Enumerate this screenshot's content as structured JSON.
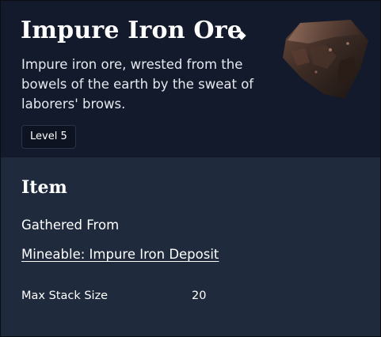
{
  "item": {
    "name": "Impure Iron Ore",
    "rarity_icon": "diamond-icon",
    "description": "Impure iron ore, wrested from the bowels of the earth by the sweat of laborers' brows.",
    "level": "Level 5",
    "image_icon": "ore-rock-icon"
  },
  "details": {
    "section_title": "Item",
    "gathered_from_label": "Gathered From",
    "gathered_from_link": "Mineable: Impure Iron Deposit",
    "stats": [
      {
        "label": "Max Stack Size",
        "value": "20"
      }
    ]
  },
  "colors": {
    "header_bg": "#121a2b",
    "body_bg": "#1f2a3d",
    "text": "#ffffff"
  }
}
